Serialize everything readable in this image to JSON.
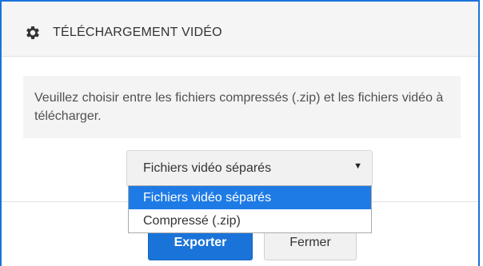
{
  "dialog": {
    "title": "TÉLÉCHARGEMENT VIDÉO",
    "icon": "gear-icon",
    "message": "Veuillez choisir entre les fichiers compressés (.zip) et les fichiers vidéo à télécharger.",
    "select": {
      "value": "Fichiers vidéo séparés",
      "arrow": "▼",
      "options": [
        {
          "label": "Fichiers vidéo séparés",
          "selected": true
        },
        {
          "label": "Compressé (.zip)",
          "selected": false
        }
      ]
    },
    "buttons": {
      "export": "Exporter",
      "close": "Fermer"
    }
  },
  "colors": {
    "accent": "#1a73d9",
    "selected_option": "#1e7be6"
  }
}
